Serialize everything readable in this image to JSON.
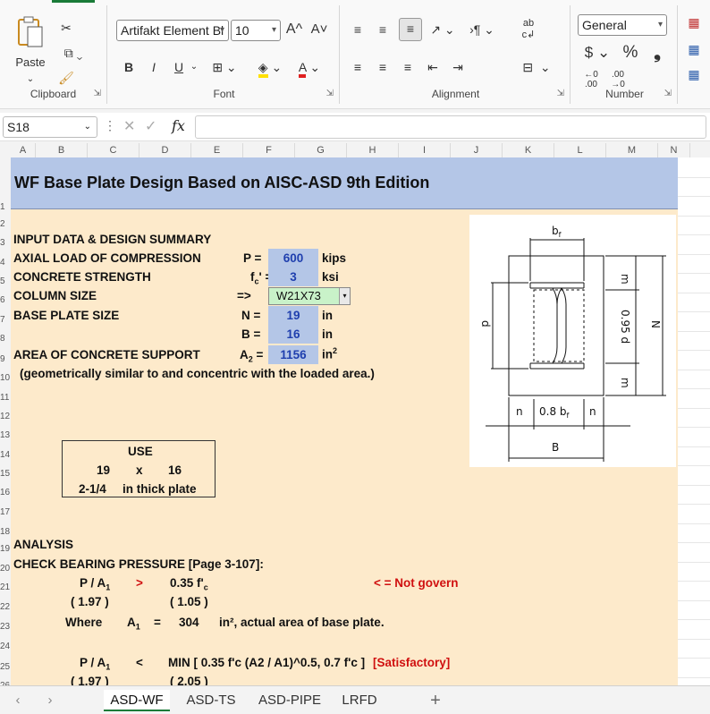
{
  "ribbon": {
    "clipboard": {
      "label": "Clipboard",
      "paste": "Paste"
    },
    "font": {
      "label": "Font",
      "name": "Artifakt Element Bl",
      "size": "10",
      "bold": "B",
      "italic": "I",
      "underline": "U"
    },
    "alignment": {
      "label": "Alignment"
    },
    "number": {
      "label": "Number",
      "format": "General",
      "currency": "$",
      "percent": "%",
      "comma": "❟"
    }
  },
  "formula_bar": {
    "cell_ref": "S18",
    "fx": "fx",
    "content": ""
  },
  "columns": [
    "A",
    "B",
    "C",
    "D",
    "E",
    "F",
    "G",
    "H",
    "I",
    "J",
    "K",
    "L",
    "M",
    "N"
  ],
  "rows": [
    "1",
    "2",
    "3",
    "4",
    "5",
    "6",
    "7",
    "8",
    "9",
    "10",
    "11",
    "12",
    "13",
    "14",
    "15",
    "16",
    "17",
    "18",
    "19",
    "20",
    "21",
    "22",
    "23",
    "24",
    "25",
    "26"
  ],
  "sheet": {
    "title": "WF Base Plate Design Based on AISC-ASD 9th Edition",
    "input_header": "INPUT DATA & DESIGN SUMMARY",
    "axial_label": "AXIAL LOAD OF COMPRESSION",
    "axial_sym": "P  =",
    "axial_val": "600",
    "axial_unit": "kips",
    "conc_label": "CONCRETE STRENGTH",
    "conc_sym": "f",
    "conc_val": "3",
    "conc_unit": "ksi",
    "col_label": "COLUMN SIZE",
    "col_arrow": "=>",
    "col_val": "W21X73",
    "bp_label": "BASE PLATE SIZE",
    "n_sym": "N  =",
    "n_val": "19",
    "n_unit": "in",
    "b_sym": "B  =",
    "b_val": "16",
    "b_unit": "in",
    "area_label": "AREA OF CONCRETE SUPPORT",
    "a2_sym": "A",
    "a2_val": "1156",
    "a2_unit": "in",
    "area_note": "(geometrically similar to and concentric with the loaded area.)",
    "use": {
      "head": "USE",
      "n": "19",
      "x": "x",
      "b": "16",
      "thick": "2-1/4",
      "plate": "in thick plate"
    },
    "analysis": "ANALYSIS",
    "check_bearing": "CHECK BEARING PRESSURE [Page 3-107]:",
    "pa1": "P / A",
    "gt": ">",
    "fc035": "0.35 f'",
    "not_govern": "< = Not govern",
    "v197": "( 1.97 )",
    "v105": "( 1.05 )",
    "where": "Where",
    "a1": "A",
    "eq": "=",
    "a1_val": "304",
    "a1_desc": "in², actual area of base plate.",
    "lt": "<",
    "min_expr": "MIN [ 0.35 f'c (A2 / A1)^0.5, 0.7 f'c ]",
    "satisfactory": "[Satisfactory]",
    "v197b": "( 1.97 )",
    "v205": "( 2.05 )"
  },
  "diagram": {
    "bf": "b",
    "bf_sub": "f",
    "m": "m",
    "d": "d",
    "d095": "0.95 d",
    "N": "N",
    "n": "n",
    "bf08": "0.8 b",
    "B": "B"
  },
  "tabs": [
    "ASD-WF",
    "ASD-TS",
    "ASD-PIPE",
    "LRFD"
  ],
  "add_tab": "+",
  "colors": {
    "title_bg": "#b4c6e7",
    "sheet_bg": "#fdeacb",
    "input_bg": "#b4c6e7",
    "input_text": "#1f3fae",
    "accent_red": "#d01010",
    "tab_accent": "#1a7b38"
  }
}
